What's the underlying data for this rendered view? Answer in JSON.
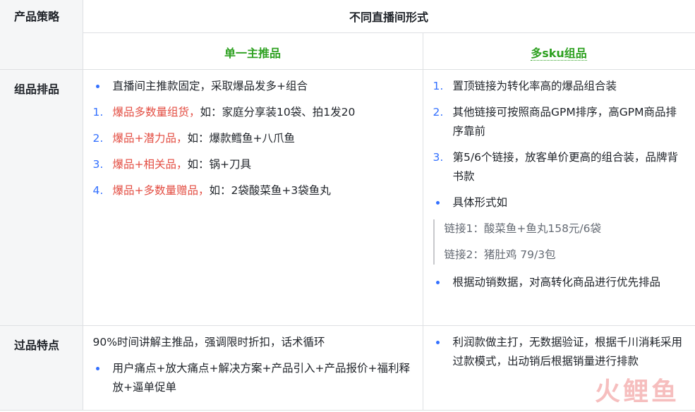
{
  "header": {
    "product_strategy": "产品策略",
    "forms_title": "不同直播间形式",
    "single_main": "单一主推品",
    "multi_sku": "多sku组品"
  },
  "rows": {
    "group": {
      "label": "组品排品",
      "single": [
        {
          "marker": "•",
          "text": "直播间主推款固定，采取爆品发多+组合"
        },
        {
          "marker": "1.",
          "red": "爆品多数量组货，",
          "text": "如：家庭分享装10袋、拍1发20"
        },
        {
          "marker": "2.",
          "red": "爆品+潜力品，",
          "text": "如：爆款鳕鱼+八爪鱼"
        },
        {
          "marker": "3.",
          "red": "爆品+相关品，",
          "text": "如：锅+刀具"
        },
        {
          "marker": "4.",
          "red": "爆品+多数量赠品，",
          "text": "如：2袋酸菜鱼+3袋鱼丸"
        }
      ],
      "multi": [
        {
          "marker": "1.",
          "text": "置顶链接为转化率高的爆品组合装"
        },
        {
          "marker": "2.",
          "text": "其他链接可按照商品GPM排序，高GPM商品排序靠前"
        },
        {
          "marker": "3.",
          "text": "第5/6个链接，放客单价更高的组合装，品牌背书款"
        },
        {
          "marker": "•",
          "text": "具体形式如"
        }
      ],
      "quote": [
        "链接1：酸菜鱼+鱼丸158元/6袋",
        "链接2：猪肚鸡 79/3包"
      ],
      "multi_after": {
        "marker": "•",
        "text": "根据动销数据，对高转化商品进行优先排品"
      }
    },
    "pass": {
      "label": "过品特点",
      "single_plain": "90%时间讲解主推品，强调限时折扣，话术循环",
      "single_items": [
        {
          "marker": "•",
          "text": "用户痛点+放大痛点+解决方案+产品引入+产品报价+福利释放+逼单促单"
        }
      ],
      "multi": [
        {
          "marker": "•",
          "text": "利润款做主打，无数据验证，根据千川消耗采用过款模式，出动销后根据销量进行排款"
        }
      ]
    }
  },
  "watermark": "火鲤鱼",
  "colors": {
    "accent_blue": "#3370ff",
    "highlight_red": "#e34d42",
    "header_green": "#2ea121",
    "label_bg": "#f5f6f7"
  }
}
